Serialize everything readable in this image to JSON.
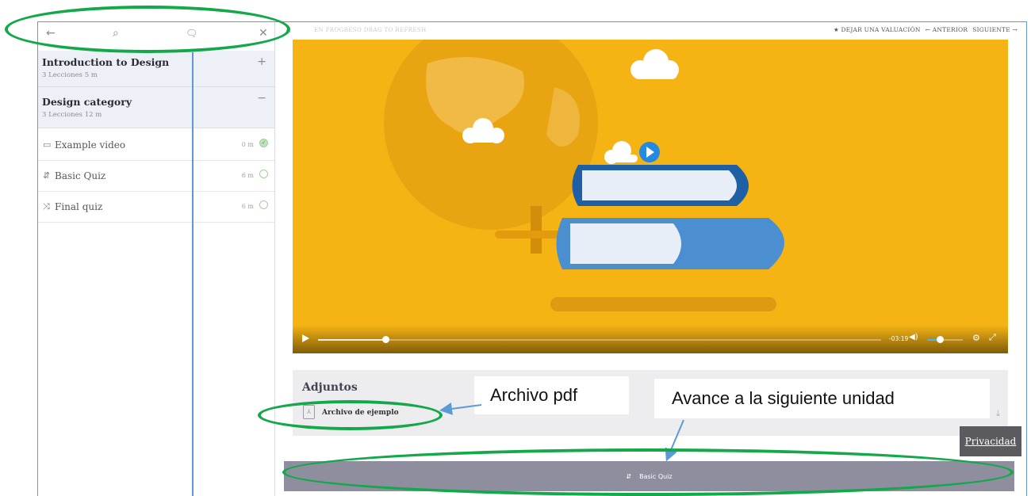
{
  "sidebar": {
    "back_icon": "←",
    "search_icon": "⌕",
    "notes_icon": "🗨",
    "close_icon": "✕",
    "sections": [
      {
        "title": "Introduction to Design",
        "meta": "3 Lecciones  5 m",
        "toggle": "+"
      },
      {
        "title": "Design category",
        "meta": "3 Lecciones  12 m",
        "toggle": "−"
      }
    ],
    "lessons": [
      {
        "icon": "▭",
        "label": "Example video",
        "duration": "0 m",
        "status": "✓"
      },
      {
        "icon": "⇵",
        "label": "Basic Quiz",
        "duration": "6 m",
        "status": ""
      },
      {
        "icon": "⤨",
        "label": "Final quiz",
        "duration": "6 m",
        "status": ""
      }
    ]
  },
  "topbar": {
    "collapse_icon": "«",
    "hint": "EN PROGRESO  DRAG TO REFRESH",
    "rate": "★ DEJAR UNA VALUACIÓN",
    "prev": "← ANTERIOR",
    "next": "SIGUIENTE →"
  },
  "player": {
    "time": "-03:19",
    "progress": 0.12,
    "volume": 0.35
  },
  "attachments": {
    "heading": "Adjuntos",
    "file_icon": "⅄",
    "file_name": "Archivo de ejemplo",
    "download_icon": "⤓"
  },
  "next_unit": {
    "icon": "⇵",
    "label": "Basic Quiz"
  },
  "privacy": "Privacidad",
  "annotations": {
    "pdf": "Archivo pdf",
    "next": "Avance a la siguiente unidad"
  },
  "colors": {
    "accent_green": "#14a84b",
    "frame_blue": "#5b9bd5",
    "video_yellow": "#f6b414",
    "button_gray": "#8e8e9e"
  }
}
